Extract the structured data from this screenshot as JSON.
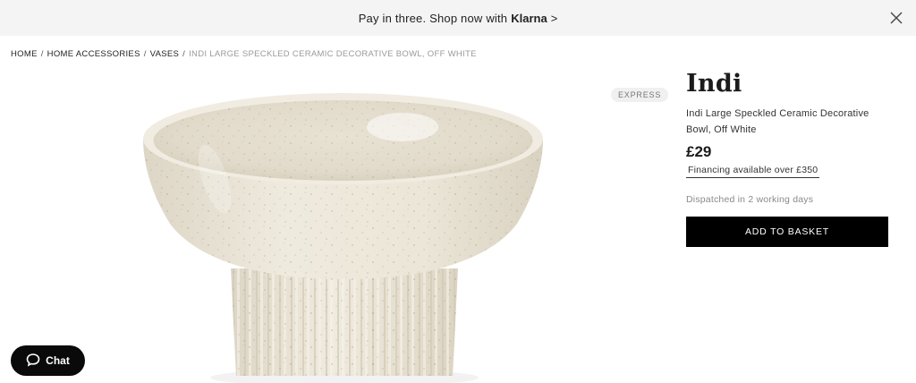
{
  "promo": {
    "text": "Pay in three. Shop now with",
    "brand": "Klarna",
    "arrow": ">"
  },
  "icons": {
    "close": "close-icon",
    "chat": "chat-bubble-icon"
  },
  "breadcrumb": {
    "items": [
      "HOME",
      "HOME ACCESSORIES",
      "VASES"
    ],
    "separator": "/",
    "current": "INDI LARGE SPECKLED CERAMIC DECORATIVE BOWL, OFF WHITE"
  },
  "badge": {
    "label": "EXPRESS"
  },
  "product": {
    "brand": "Indi",
    "name": "Indi Large Speckled Ceramic Decorative Bowl, Off White",
    "price": "£29",
    "finance": "Financing available over £350",
    "dispatch": "Dispatched in 2 working days",
    "add_label": "ADD TO BASKET"
  },
  "chat": {
    "label": "Chat"
  },
  "colors": {
    "promo_bg": "#f4f4f4",
    "button_bg": "#000000",
    "ceramic": "#ece6d8"
  }
}
